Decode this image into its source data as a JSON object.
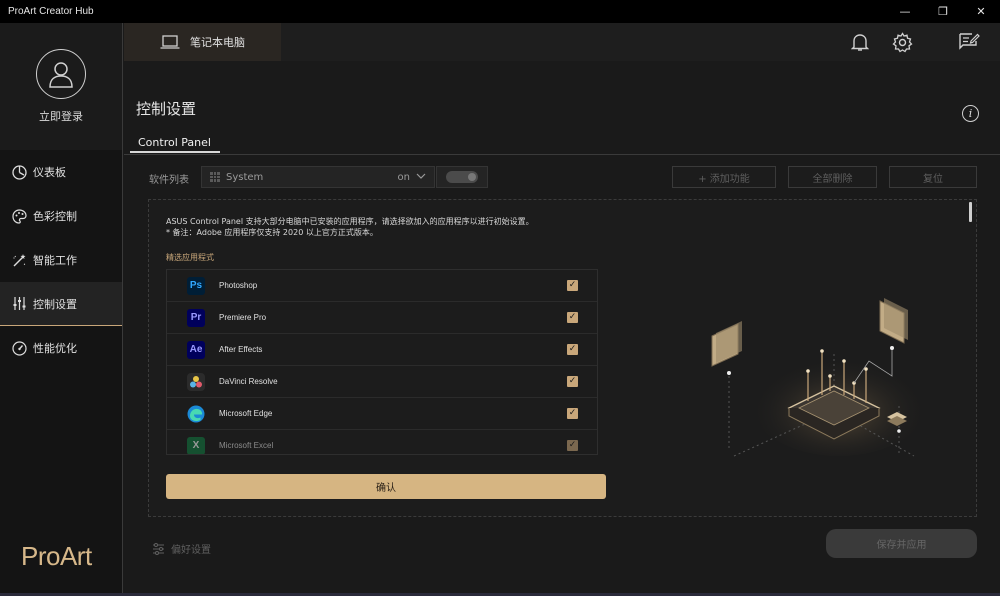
{
  "window": {
    "title": "ProArt Creator Hub",
    "controls": [
      "minimize",
      "restore",
      "close"
    ]
  },
  "sidebar": {
    "login_label": "立即登录",
    "brand": "ProArt",
    "items": [
      {
        "label": "仪表板",
        "icon": "dashboard-icon"
      },
      {
        "label": "色彩控制",
        "icon": "palette-icon"
      },
      {
        "label": "智能工作",
        "icon": "magic-wand-icon"
      },
      {
        "label": "控制设置",
        "icon": "sliders-icon",
        "active": true
      },
      {
        "label": "性能优化",
        "icon": "gauge-icon"
      }
    ]
  },
  "topbar": {
    "device_tab": "笔记本电脑",
    "icons": [
      "bell-icon",
      "gear-icon",
      "feedback-icon"
    ]
  },
  "main": {
    "title": "控制设置",
    "tab": "Control Panel",
    "software_list_label": "软件列表",
    "selected_software": "System",
    "selected_state": "on",
    "buttons": {
      "add": "+ 添加功能",
      "delete_all": "全部删除",
      "reset": "复位"
    },
    "description_line1": "ASUS Control Panel 支持大部分电脑中已安装的应用程序，请选择欲加入的应用程序以进行初始设置。",
    "description_line2": "* 备注：Adobe 应用程序仅支持 2020 以上官方正式版本。",
    "selected_apps_label": "精选应用程式",
    "apps": [
      {
        "name": "Photoshop",
        "abbr": "Ps",
        "checked": true
      },
      {
        "name": "Premiere Pro",
        "abbr": "Pr",
        "checked": true
      },
      {
        "name": "After Effects",
        "abbr": "Ae",
        "checked": true
      },
      {
        "name": "DaVinci Resolve",
        "abbr": "",
        "checked": true
      },
      {
        "name": "Microsoft Edge",
        "abbr": "",
        "checked": true
      },
      {
        "name": "Microsoft Excel",
        "abbr": "X",
        "checked": true
      }
    ],
    "confirm_label": "确认",
    "preferences_label": "偏好设置",
    "save_apply_label": "保存并应用"
  },
  "colors": {
    "accent": "#c9a77a",
    "confirm_bg": "#d6b582"
  }
}
